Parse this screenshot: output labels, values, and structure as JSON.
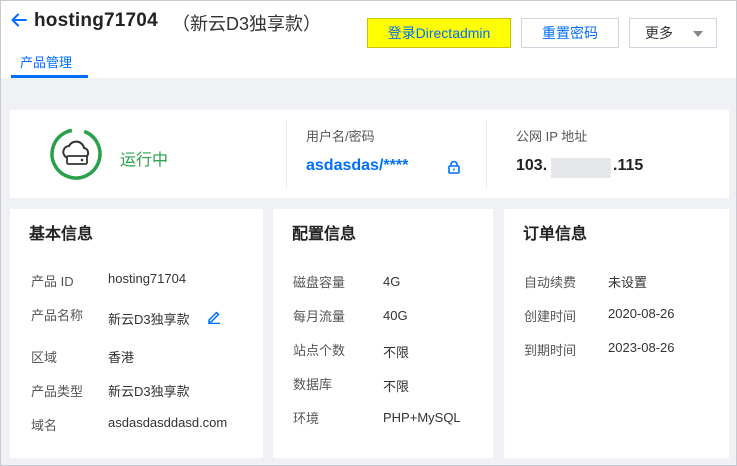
{
  "header": {
    "title": "hosting71704",
    "subtitle": "（新云D3独享款）",
    "buttons": {
      "login": "登录Directadmin",
      "reset": "重置密码",
      "more": "更多"
    },
    "tabs": [
      {
        "label": "产品管理",
        "active": true
      }
    ]
  },
  "status": {
    "text": "运行中",
    "credentials_label": "用户名/密码",
    "credentials_value": "asdasdas/****",
    "ip_label": "公网 IP 地址",
    "ip_prefix": "103.",
    "ip_suffix": ".115"
  },
  "basic": {
    "title": "基本信息",
    "rows": [
      {
        "label": "产品 ID",
        "value": "hosting71704"
      },
      {
        "label": "产品名称",
        "value": "新云D3独享款"
      },
      {
        "label": "区域",
        "value": "香港"
      },
      {
        "label": "产品类型",
        "value": "新云D3独享款"
      },
      {
        "label": "域名",
        "value": "asdasdasddasd.com"
      }
    ]
  },
  "config": {
    "title": "配置信息",
    "rows": [
      {
        "label": "磁盘容量",
        "value": "4G"
      },
      {
        "label": "每月流量",
        "value": "40G"
      },
      {
        "label": "站点个数",
        "value": "不限"
      },
      {
        "label": "数据库",
        "value": "不限"
      },
      {
        "label": "环境",
        "value": "PHP+MySQL"
      }
    ]
  },
  "order": {
    "title": "订单信息",
    "rows": [
      {
        "label": "自动续费",
        "value": "未设置"
      },
      {
        "label": "创建时间",
        "value": "2020-08-26"
      },
      {
        "label": "到期时间",
        "value": "2023-08-26"
      }
    ]
  },
  "colors": {
    "accent": "#006eff",
    "login_button": "#ffff00",
    "running": "#29a14b"
  },
  "icons": [
    "back-arrow-icon",
    "server-status-icon",
    "lock-icon",
    "edit-pencil-icon",
    "caret-down-icon"
  ]
}
